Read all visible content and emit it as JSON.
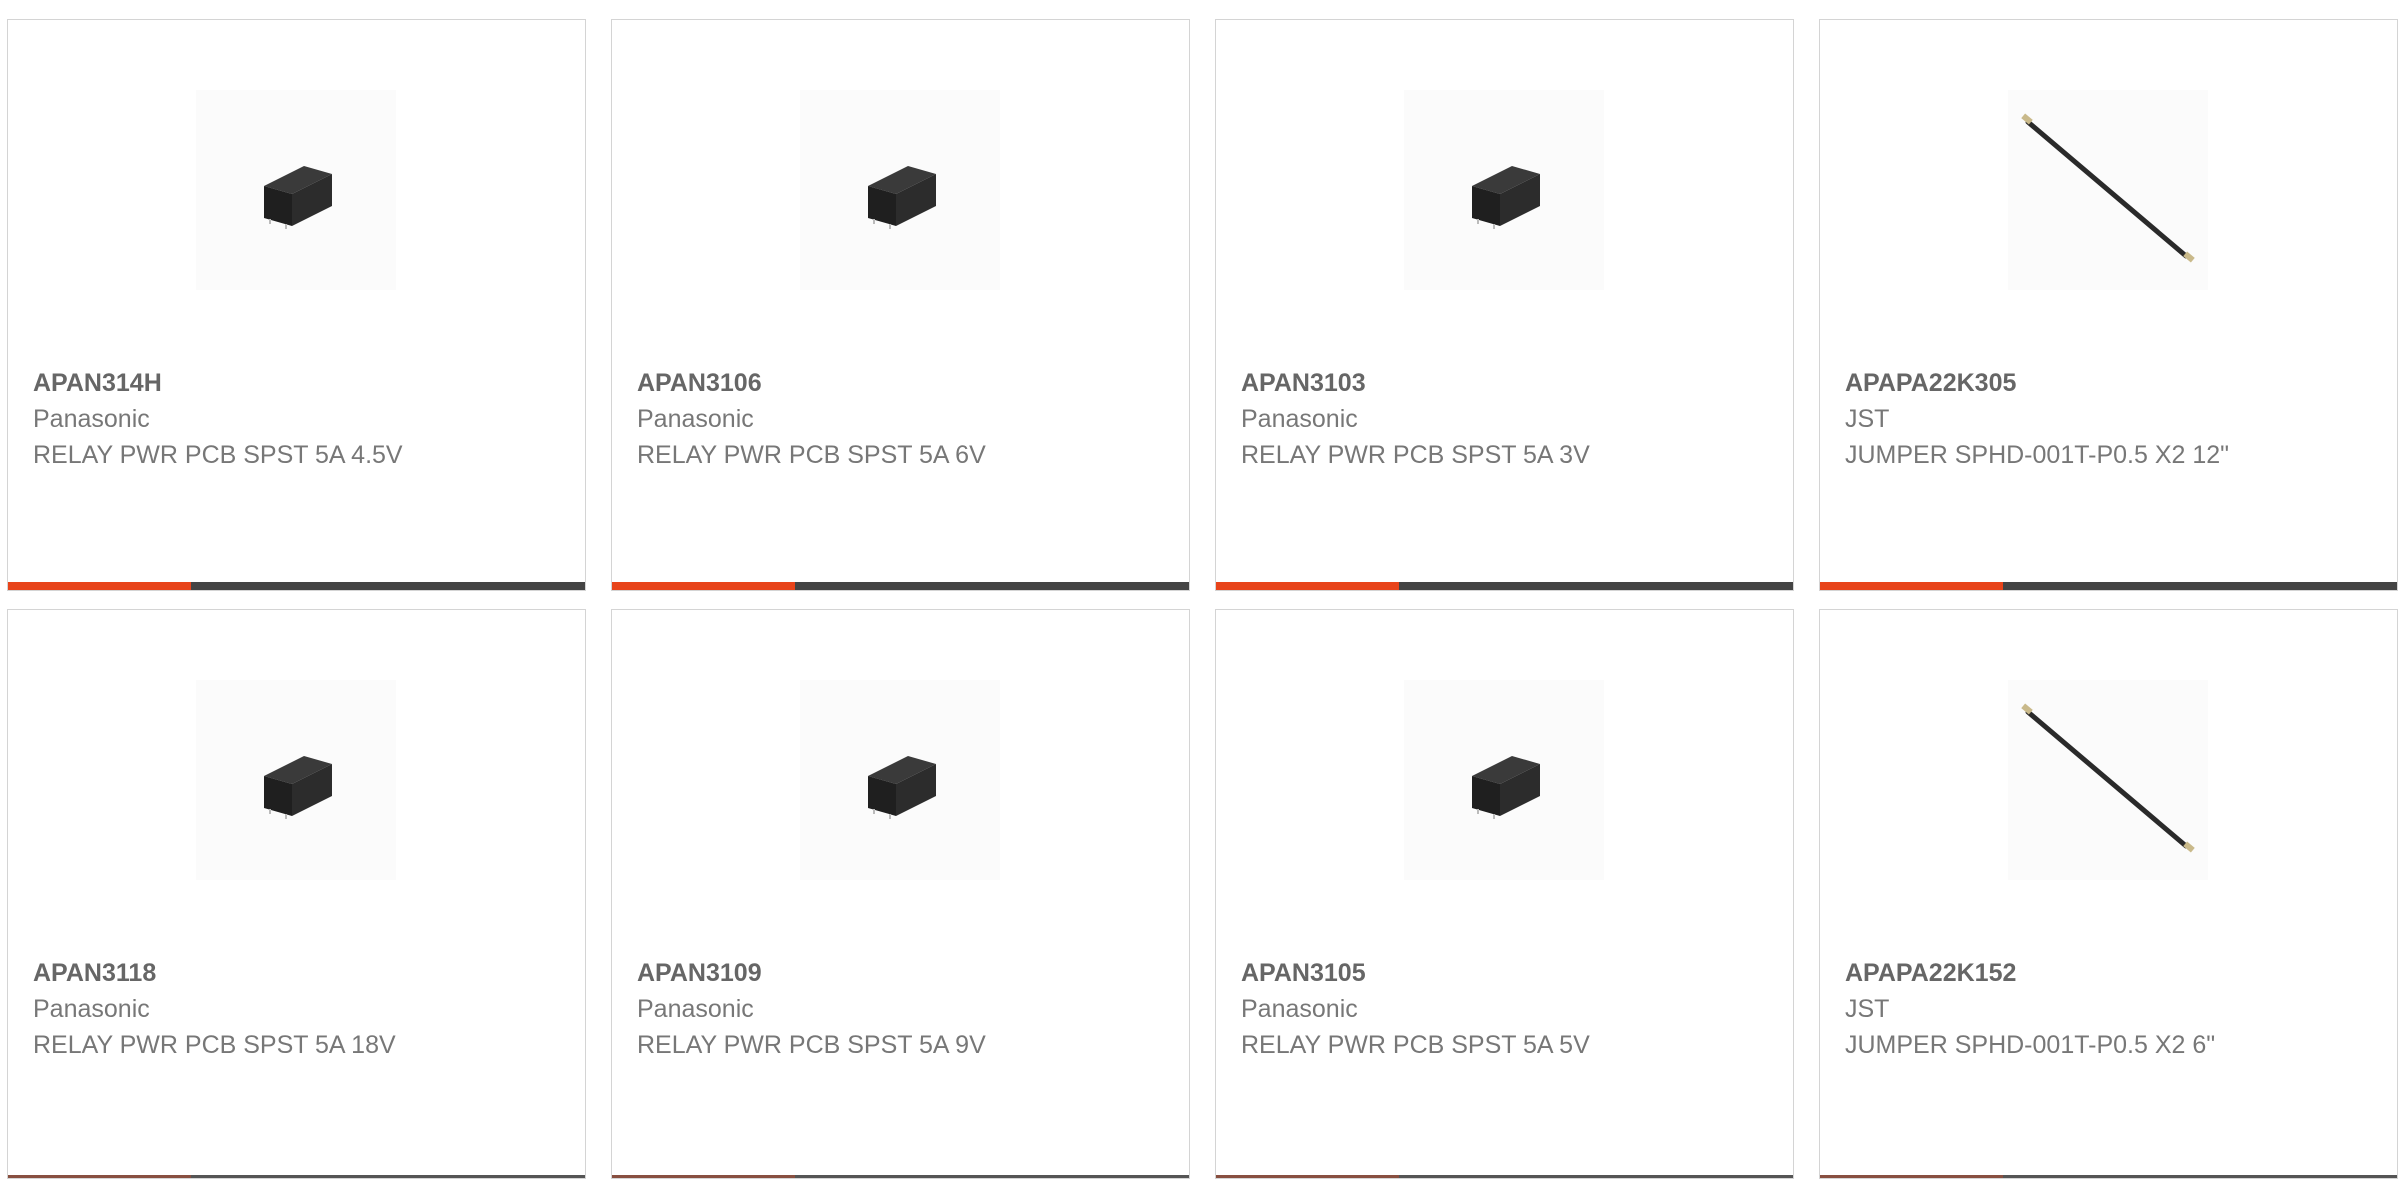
{
  "theme": {
    "accent": "#e8441a",
    "bar": "#444444"
  },
  "products": [
    {
      "part_no": "APAN314H",
      "maker": "Panasonic",
      "desc": "RELAY PWR PCB SPST 5A 4.5V",
      "image": "relay-image"
    },
    {
      "part_no": "APAN3106",
      "maker": "Panasonic",
      "desc": "RELAY PWR PCB SPST 5A 6V",
      "image": "relay-image"
    },
    {
      "part_no": "APAN3103",
      "maker": "Panasonic",
      "desc": "RELAY PWR PCB SPST 5A 3V",
      "image": "relay-image"
    },
    {
      "part_no": "APAPA22K305",
      "maker": "JST",
      "desc": "JUMPER SPHD-001T-P0.5 X2 12\"",
      "image": "jumper-wire-image"
    },
    {
      "part_no": "APAN3118",
      "maker": "Panasonic",
      "desc": "RELAY PWR PCB SPST 5A 18V",
      "image": "relay-image"
    },
    {
      "part_no": "APAN3109",
      "maker": "Panasonic",
      "desc": "RELAY PWR PCB SPST 5A 9V",
      "image": "relay-image"
    },
    {
      "part_no": "APAN3105",
      "maker": "Panasonic",
      "desc": "RELAY PWR PCB SPST 5A 5V",
      "image": "relay-image"
    },
    {
      "part_no": "APAPA22K152",
      "maker": "JST",
      "desc": "JUMPER SPHD-001T-P0.5 X2 6\"",
      "image": "jumper-wire-image"
    }
  ]
}
